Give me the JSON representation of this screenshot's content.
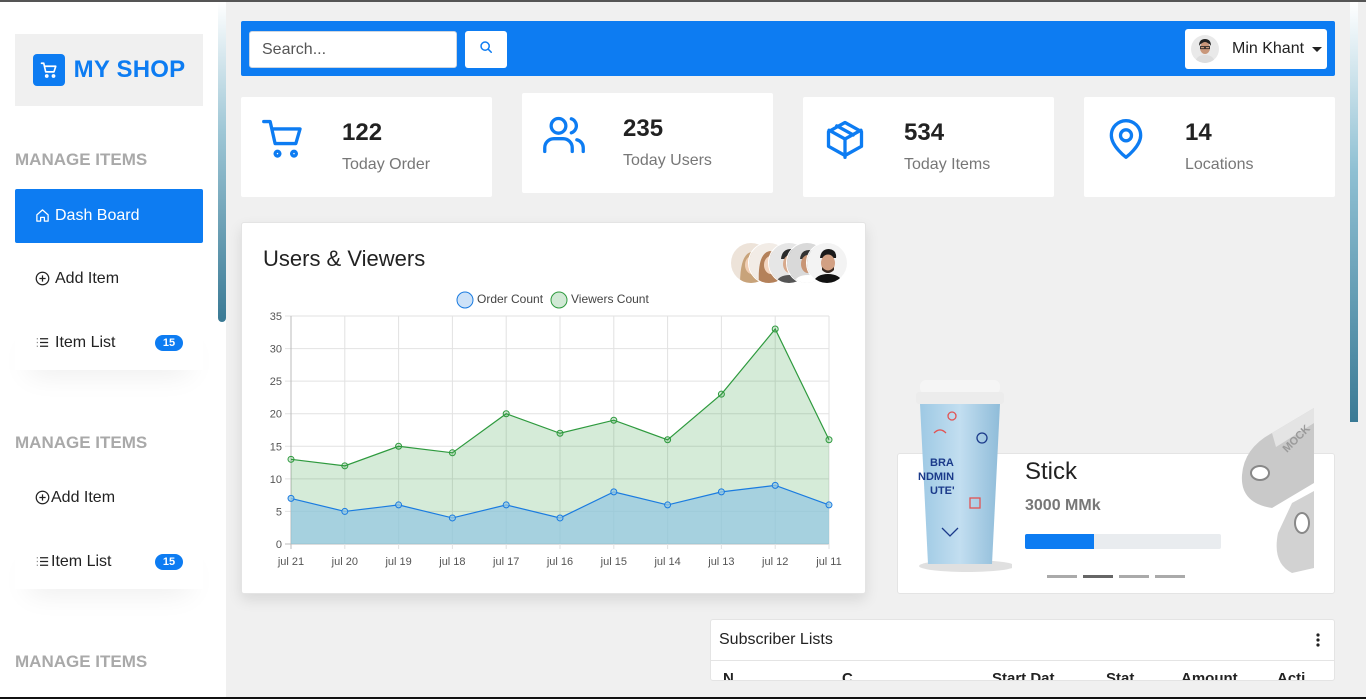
{
  "brand": {
    "name": "MY SHOP",
    "icon": "cart-icon",
    "color": "#0d7cf2"
  },
  "sidebar": {
    "sections": [
      {
        "heading": "MANAGE ITEMS"
      },
      {
        "heading": "MANAGE ITEMS"
      },
      {
        "heading": "MANAGE ITEMS"
      }
    ],
    "items": [
      {
        "label": "Dash Board",
        "icon": "home-icon",
        "active": true
      },
      {
        "label": "Add Item",
        "icon": "plus-circle-icon"
      },
      {
        "label": "Item List",
        "icon": "list-icon",
        "badge": "15"
      },
      {
        "label": "Add Item",
        "icon": "plus-circle-icon"
      },
      {
        "label": "Item List",
        "icon": "list-icon",
        "badge": "15"
      }
    ]
  },
  "topbar": {
    "search_placeholder": "Search...",
    "search_icon": "search-icon",
    "user_name": "Min Khant"
  },
  "stats": [
    {
      "value": "122",
      "label": "Today Order",
      "icon": "cart-icon"
    },
    {
      "value": "235",
      "label": "Today Users",
      "icon": "users-icon"
    },
    {
      "value": "534",
      "label": "Today Items",
      "icon": "box-icon"
    },
    {
      "value": "14",
      "label": "Locations",
      "icon": "map-pin-icon"
    }
  ],
  "chart_data": {
    "type": "area",
    "title": "Users & Viewers",
    "categories": [
      "jul 21",
      "jul 20",
      "jul 19",
      "jul 18",
      "jul 17",
      "jul 16",
      "jul 15",
      "jul 14",
      "jul 13",
      "jul 12",
      "jul 11"
    ],
    "series": [
      {
        "name": "Order Count",
        "values": [
          7,
          5,
          6,
          4,
          6,
          4,
          8,
          6,
          8,
          9,
          6
        ],
        "color": "#1a7be0"
      },
      {
        "name": "Viewers Count",
        "values": [
          13,
          12,
          15,
          14,
          20,
          17,
          19,
          16,
          23,
          33,
          16
        ],
        "color": "#2e9a3e"
      }
    ],
    "ylim": [
      0,
      35
    ],
    "yticks": [
      0,
      5,
      10,
      15,
      20,
      25,
      30,
      35
    ],
    "grid": true,
    "legend": "top-center"
  },
  "product": {
    "name": "Stick",
    "price": "3000 MMk",
    "progress": 0.35,
    "carousel_pages": 4,
    "carousel_active": 1
  },
  "subscribers": {
    "title": "Subscriber Lists",
    "columns": [
      "N",
      "C",
      "Start Dat",
      "Stat",
      "Amount",
      "Acti"
    ]
  }
}
